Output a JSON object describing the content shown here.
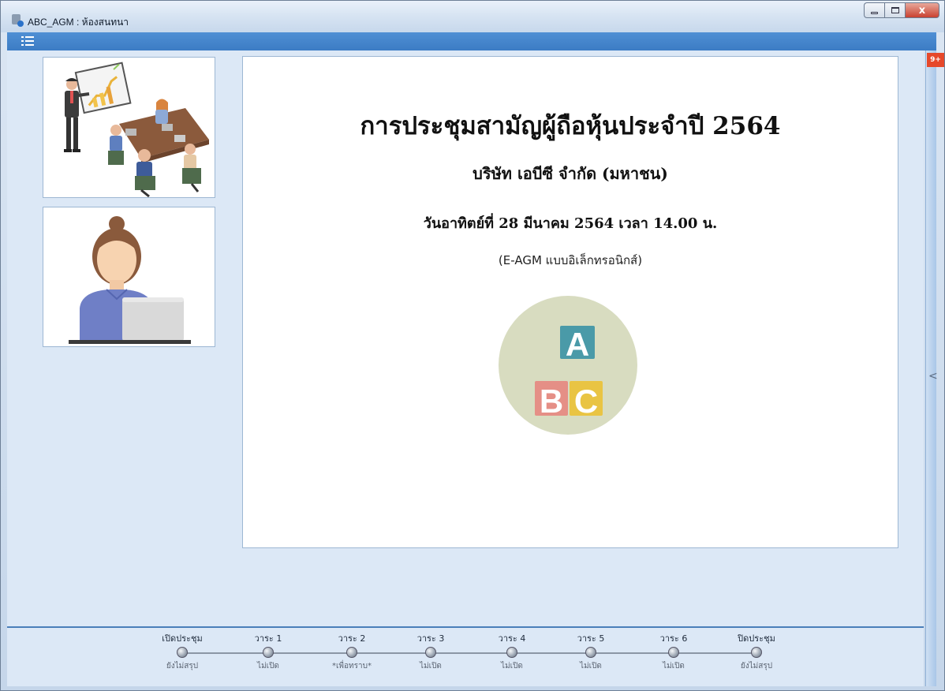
{
  "window": {
    "title": "ABC_AGM : ห้องสนทนา",
    "close_glyph": "x"
  },
  "toolbar": {
    "menu_icon": "list-icon"
  },
  "slide": {
    "title": "การประชุมสามัญผู้ถือหุ้นประจำปี 2564",
    "company": "บริษัท  เอบีซี  จำกัด  (มหาชน)",
    "date_line": "วันอาทิตย์ที่ 28  มีนาคม 2564  เวลา 14.00  น.",
    "mode": "(E-AGM แบบอิเล็กทรอนิกส์)",
    "logo": {
      "letters": [
        "A",
        "B",
        "C"
      ]
    }
  },
  "side_panel": {
    "notification_badge": "9+",
    "collapse_glyph": "<"
  },
  "agenda": [
    {
      "label": "เปิดประชุม",
      "status": "ยังไม่สรุป"
    },
    {
      "label": "วาระ 1",
      "status": "ไม่เปิด"
    },
    {
      "label": "วาระ 2",
      "status": "*เพื่อทราบ*"
    },
    {
      "label": "วาระ 3",
      "status": "ไม่เปิด"
    },
    {
      "label": "วาระ 4",
      "status": "ไม่เปิด"
    },
    {
      "label": "วาระ 5",
      "status": "ไม่เปิด"
    },
    {
      "label": "วาระ 6",
      "status": "ไม่เปิด"
    },
    {
      "label": "ปิดประชุม",
      "status": "ยังไม่สรุป"
    }
  ],
  "colors": {
    "toolbar_blue": "#3c7cc4",
    "logo_circle": "#d8dcc0",
    "logo_a": "#4a9aa8",
    "logo_b": "#e58f86",
    "logo_c": "#e9c443",
    "badge": "#e6482a"
  }
}
